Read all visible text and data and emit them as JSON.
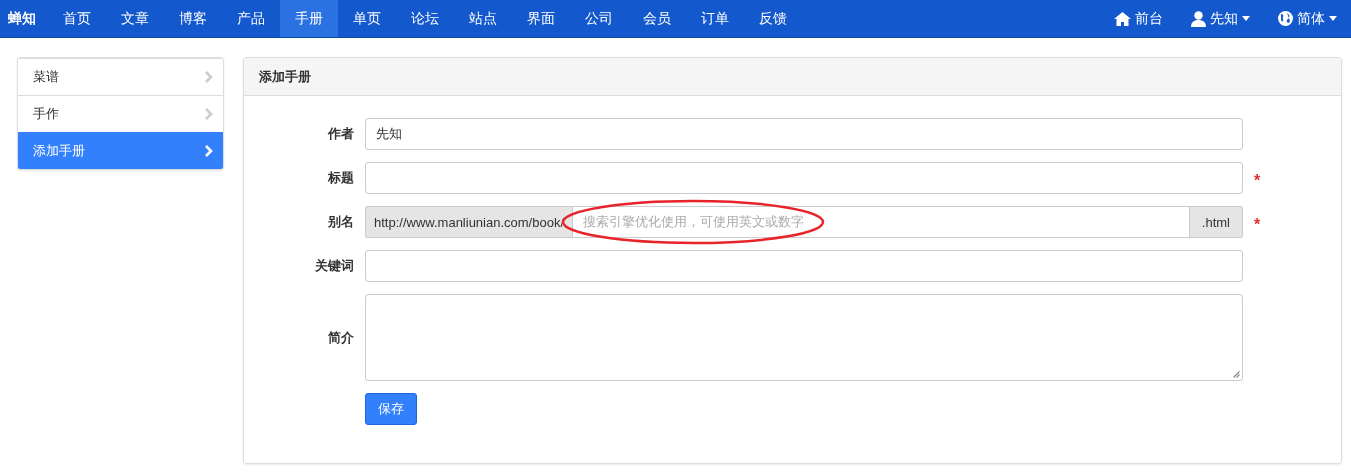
{
  "navbar": {
    "brand": "蝉知",
    "items": [
      {
        "label": "首页",
        "selected": false
      },
      {
        "label": "文章",
        "selected": false
      },
      {
        "label": "博客",
        "selected": false
      },
      {
        "label": "产品",
        "selected": false
      },
      {
        "label": "手册",
        "selected": true
      },
      {
        "label": "单页",
        "selected": false
      },
      {
        "label": "论坛",
        "selected": false
      },
      {
        "label": "站点",
        "selected": false
      },
      {
        "label": "界面",
        "selected": false
      },
      {
        "label": "公司",
        "selected": false
      },
      {
        "label": "会员",
        "selected": false
      },
      {
        "label": "订单",
        "selected": false
      },
      {
        "label": "反馈",
        "selected": false
      }
    ],
    "right": [
      {
        "kind": "home",
        "label": "前台",
        "dropdown": false
      },
      {
        "kind": "user",
        "label": "先知",
        "dropdown": true
      },
      {
        "kind": "globe",
        "label": "简体",
        "dropdown": true
      }
    ]
  },
  "sidebar": {
    "items": [
      {
        "label": "菜谱",
        "selected": false
      },
      {
        "label": "手作",
        "selected": false
      },
      {
        "label": "添加手册",
        "selected": true
      }
    ]
  },
  "panel": {
    "title": "添加手册",
    "fields": [
      {
        "kind": "text",
        "label": "作者",
        "value": "先知"
      },
      {
        "kind": "text",
        "label": "标题",
        "required_mark": "*"
      },
      {
        "kind": "addon",
        "label": "别名",
        "prefix": "http://www.manliunian.com/book/",
        "placeholder": "搜索引擎优化使用，可使用英文或数字",
        "suffix": ".html",
        "required_mark": "*",
        "highlighted": true
      },
      {
        "kind": "text",
        "label": "关键词"
      },
      {
        "kind": "textarea",
        "label": "简介"
      }
    ],
    "button": "保存"
  }
}
